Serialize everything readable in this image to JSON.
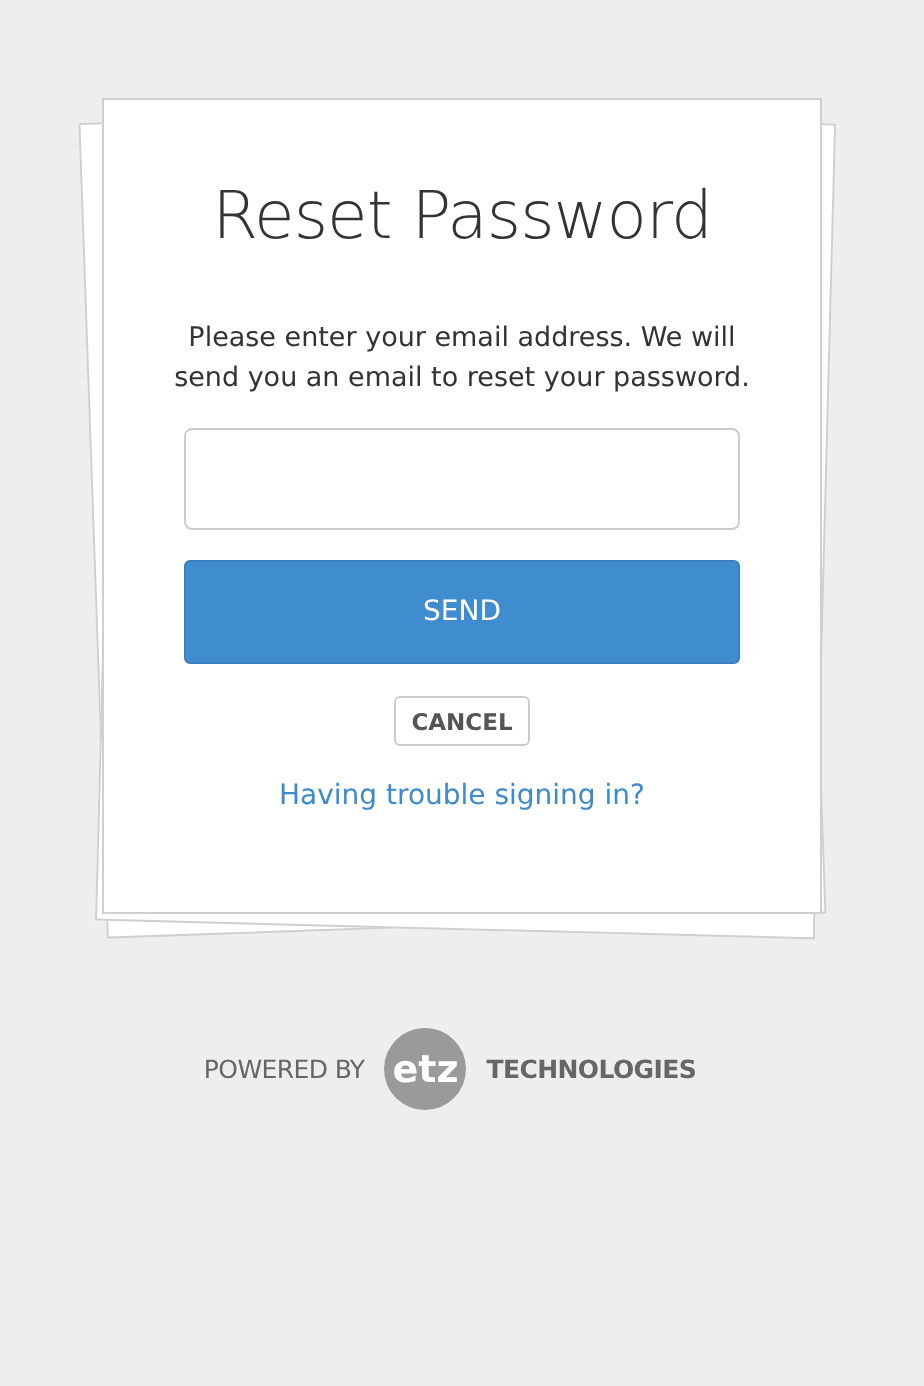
{
  "title": "Reset Password",
  "instructions": "Please enter your email address. We will send you an email to reset your password.",
  "send_button": "SEND",
  "cancel_button": "CANCEL",
  "help_link": "Having trouble signing in?",
  "footer": {
    "powered_by": "POWERED BY",
    "logo": "etz",
    "company": "TECHNOLOGIES"
  }
}
